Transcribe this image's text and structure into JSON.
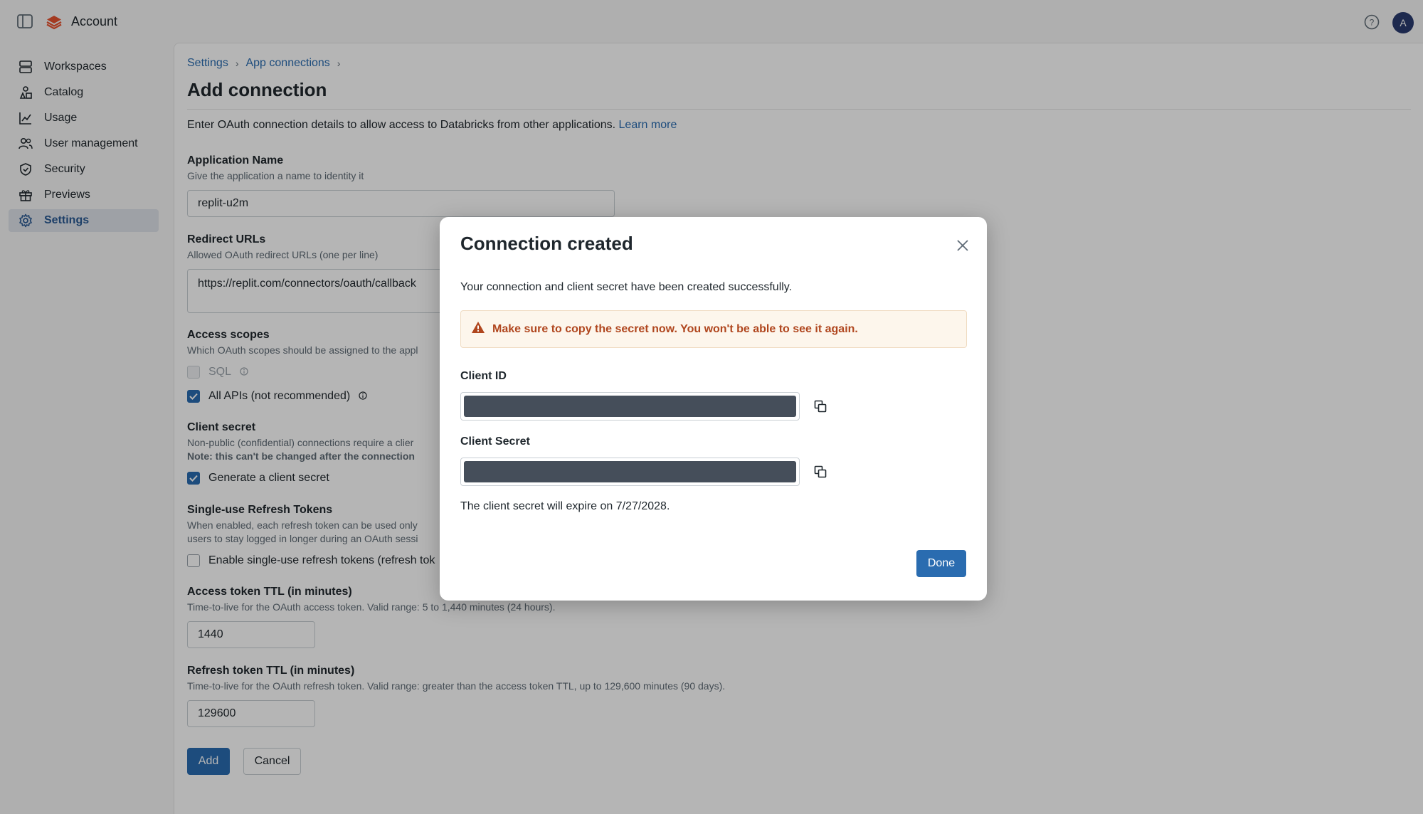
{
  "app": {
    "title": "Account",
    "avatar_initial": "A"
  },
  "sidebar": {
    "items": [
      {
        "label": "Workspaces",
        "icon": "workspaces-icon"
      },
      {
        "label": "Catalog",
        "icon": "catalog-icon"
      },
      {
        "label": "Usage",
        "icon": "usage-chart-icon"
      },
      {
        "label": "User management",
        "icon": "users-icon"
      },
      {
        "label": "Security",
        "icon": "shield-icon"
      },
      {
        "label": "Previews",
        "icon": "gift-icon"
      },
      {
        "label": "Settings",
        "icon": "gear-icon",
        "active": true
      }
    ]
  },
  "breadcrumb": {
    "items": [
      "Settings",
      "App connections"
    ],
    "separator": "›"
  },
  "page": {
    "title": "Add connection",
    "description": "Enter OAuth connection details to allow access to Databricks from other applications.",
    "learn_more": "Learn more"
  },
  "form": {
    "app_name": {
      "label": "Application Name",
      "hint": "Give the application a name to identity it",
      "value": "replit-u2m"
    },
    "redirect": {
      "label": "Redirect URLs",
      "hint": "Allowed OAuth redirect URLs (one per line)",
      "value": "https://replit.com/connectors/oauth/callback"
    },
    "scopes": {
      "label": "Access scopes",
      "hint": "Which OAuth scopes should be assigned to the appl",
      "sql_label": "SQL",
      "sql_checked": false,
      "all_apis_label": "All APIs (not recommended)",
      "all_apis_checked": true
    },
    "client_secret": {
      "label": "Client secret",
      "hint": "Non-public (confidential) connections require a clier",
      "note": "Note: this can't be changed after the connection",
      "generate_label": "Generate a client secret",
      "generate_checked": true
    },
    "refresh": {
      "label": "Single-use Refresh Tokens",
      "hint_line1": "When enabled, each refresh token can be used only",
      "hint_line2": "users to stay logged in longer during an OAuth sessi",
      "enable_label": "Enable single-use refresh tokens (refresh tok",
      "enable_checked": false
    },
    "access_ttl": {
      "label": "Access token TTL (in minutes)",
      "hint": "Time-to-live for the OAuth access token. Valid range: 5 to 1,440 minutes (24 hours).",
      "value": "1440"
    },
    "refresh_ttl": {
      "label": "Refresh token TTL (in minutes)",
      "hint": "Time-to-live for the OAuth refresh token. Valid range: greater than the access token TTL, up to 129,600 minutes (90 days).",
      "value": "129600"
    },
    "add_label": "Add",
    "cancel_label": "Cancel"
  },
  "modal": {
    "title": "Connection created",
    "message": "Your connection and client secret have been created successfully.",
    "warning": "Make sure to copy the secret now. You won't be able to see it again.",
    "client_id_label": "Client ID",
    "client_secret_label": "Client Secret",
    "expire_text": "The client secret will expire on 7/27/2028.",
    "done_label": "Done"
  },
  "colors": {
    "accent": "#2a6cb0",
    "warning": "#b0461e",
    "mask": "#454e5a"
  }
}
